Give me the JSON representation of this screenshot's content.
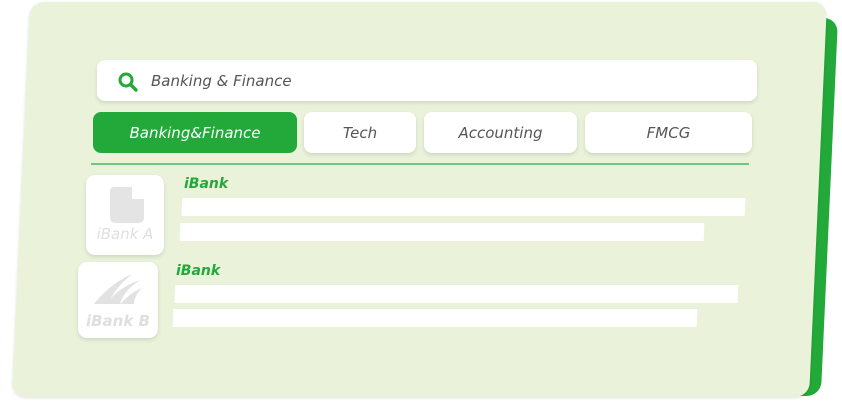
{
  "search": {
    "value": "Banking & Finance",
    "icon": "search-icon"
  },
  "tabs": [
    {
      "label": "Banking&Finance",
      "active": true
    },
    {
      "label": "Tech",
      "active": false
    },
    {
      "label": "Accounting",
      "active": false
    },
    {
      "label": "FMCG",
      "active": false
    }
  ],
  "results": [
    {
      "logo_text": "iBank A",
      "logo_icon": "document-icon",
      "title": "iBank"
    },
    {
      "logo_text": "iBank B",
      "logo_icon": "wave-logo-icon",
      "title": "iBank"
    }
  ],
  "colors": {
    "accent": "#23a939",
    "card_background": "#eaf3da",
    "divider": "#6cc97d"
  }
}
